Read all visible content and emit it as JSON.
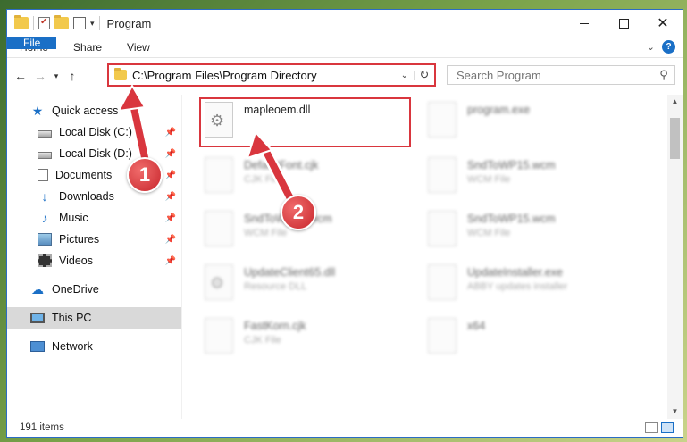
{
  "window": {
    "title": "Program"
  },
  "ribbon": {
    "tabs": [
      "File",
      "Home",
      "Share",
      "View"
    ],
    "help": "?"
  },
  "address": {
    "path": "C:\\Program Files\\Program Directory"
  },
  "search": {
    "placeholder": "Search Program"
  },
  "sidebar": {
    "items": [
      {
        "label": "Quick access",
        "icon": "star-icon"
      },
      {
        "label": "Local Disk (C:)",
        "icon": "disk-icon",
        "pinned": true
      },
      {
        "label": "Local Disk (D:)",
        "icon": "disk-icon",
        "pinned": true
      },
      {
        "label": "Documents",
        "icon": "documents-icon",
        "pinned": true
      },
      {
        "label": "Downloads",
        "icon": "download-icon",
        "pinned": true
      },
      {
        "label": "Music",
        "icon": "music-icon",
        "pinned": true
      },
      {
        "label": "Pictures",
        "icon": "pictures-icon",
        "pinned": true
      },
      {
        "label": "Videos",
        "icon": "videos-icon",
        "pinned": true
      },
      {
        "label": "OneDrive",
        "icon": "cloud-icon"
      },
      {
        "label": "This PC",
        "icon": "pc-icon",
        "selected": true
      },
      {
        "label": "Network",
        "icon": "network-icon"
      }
    ]
  },
  "files": [
    {
      "name": "mapleoem.dll",
      "type": ""
    },
    {
      "name": "program.exe",
      "type": ""
    },
    {
      "name": "DefaultFont.cjk",
      "type": "CJK File"
    },
    {
      "name": "SndToWP15.wcm",
      "type": "WCM File"
    },
    {
      "name": "SndToWP15.wcm",
      "type": "WCM File"
    },
    {
      "name": "SndToWP15.wcm",
      "type": "WCM File"
    },
    {
      "name": "UpdateClient65.dll",
      "type": "Resource DLL"
    },
    {
      "name": "UpdateInstaller.exe",
      "type": "ABBY updates installer"
    },
    {
      "name": "FastKorn.cjk",
      "type": "CJK File"
    },
    {
      "name": "x64",
      "type": ""
    }
  ],
  "status": {
    "count": "191 items"
  },
  "callouts": [
    "1",
    "2"
  ],
  "colors": {
    "accent": "#1a6fc6",
    "highlight": "#d9363e"
  }
}
